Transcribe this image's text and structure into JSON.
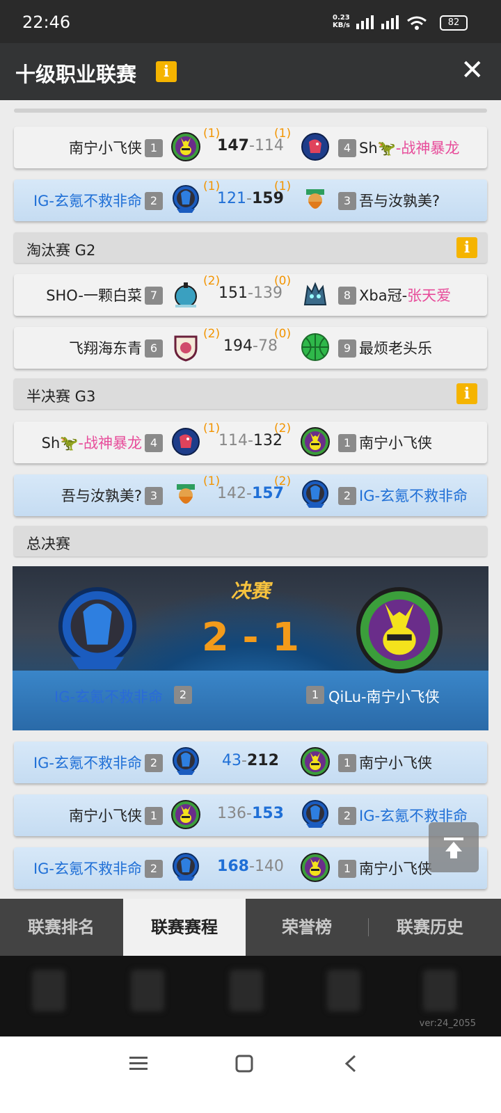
{
  "status": {
    "time": "22:46",
    "net_speed_top": "0.23",
    "net_speed_bottom": "KB/s",
    "battery": "82"
  },
  "header": {
    "title": "十级职业联赛",
    "info": "i",
    "close": "✕"
  },
  "colors": {
    "accent_orange": "#f29400",
    "blue_team": "#1f6fd6",
    "pink": "#e74c9a",
    "info_badge": "#f5b400"
  },
  "matches_top": [
    {
      "left_name": "南宁小飞侠",
      "left_seed": "1",
      "left_wins": "(1)",
      "left_score": "147",
      "right_score": "114",
      "right_wins": "(1)",
      "right_seed": "4",
      "right_name_prefix": "Sh",
      "right_name_suffix": "-战神暴龙",
      "left_logo": "bunny-logo-icon",
      "right_logo": "dragon-red-logo-icon"
    },
    {
      "left_name": "IG-玄氪不救非命",
      "left_seed": "2",
      "left_wins": "(1)",
      "left_score": "121",
      "right_score": "159",
      "right_wins": "(1)",
      "right_seed": "3",
      "right_name": "吾与汝孰美?",
      "left_logo": "blue-dragon-logo-icon",
      "right_logo": "bearded-warrior-logo-icon"
    }
  ],
  "sections": {
    "g2": "淘汰赛 G2",
    "g3": "半决赛 G3",
    "final": "总决赛"
  },
  "matches_g2": [
    {
      "left_name": "SHO-一颗白菜",
      "left_seed": "7",
      "left_wins": "(2)",
      "left_score": "151",
      "right_score": "139",
      "right_wins": "(0)",
      "right_seed": "8",
      "right_name_prefix": "Xba冠-",
      "right_name_suffix": "张天爱"
    },
    {
      "left_name": "飞翔海东青",
      "left_seed": "6",
      "left_wins": "(2)",
      "left_score": "194",
      "right_score": "78",
      "right_wins": "(0)",
      "right_seed": "9",
      "right_name": "最烦老头乐"
    }
  ],
  "matches_g3": [
    {
      "left_name_prefix": "Sh",
      "left_name_suffix": "-战神暴龙",
      "left_seed": "4",
      "left_wins": "(1)",
      "left_score": "114",
      "right_score": "132",
      "right_wins": "(2)",
      "right_seed": "1",
      "right_name": "南宁小飞侠"
    },
    {
      "left_name": "吾与汝孰美?",
      "left_seed": "3",
      "left_wins": "(1)",
      "left_score": "142",
      "right_score": "157",
      "right_wins": "(2)",
      "right_seed": "2",
      "right_name": "IG-玄氪不救非命"
    }
  ],
  "final": {
    "title": "决赛",
    "score": "2 - 1",
    "left_name": "IG-玄氪不救非命",
    "left_seed": "2",
    "right_seed": "1",
    "right_name": "QiLu-南宁小飞侠"
  },
  "final_games": [
    {
      "left_name": "IG-玄氪不救非命",
      "left_seed": "2",
      "left_score": "43",
      "right_score": "212",
      "right_seed": "1",
      "right_name": "南宁小飞侠"
    },
    {
      "left_name": "南宁小飞侠",
      "left_seed": "1",
      "left_score": "136",
      "right_score": "153",
      "right_seed": "2",
      "right_name": "IG-玄氪不救非命"
    },
    {
      "left_name": "IG-玄氪不救非命",
      "left_seed": "2",
      "left_score": "168",
      "right_score": "140",
      "right_seed": "1",
      "right_name": "南宁小飞侠"
    }
  ],
  "tabs": [
    "联赛排名",
    "联赛赛程",
    "荣誉榜",
    "联赛历史"
  ],
  "active_tab": "联赛赛程",
  "version": "ver:24_2055"
}
